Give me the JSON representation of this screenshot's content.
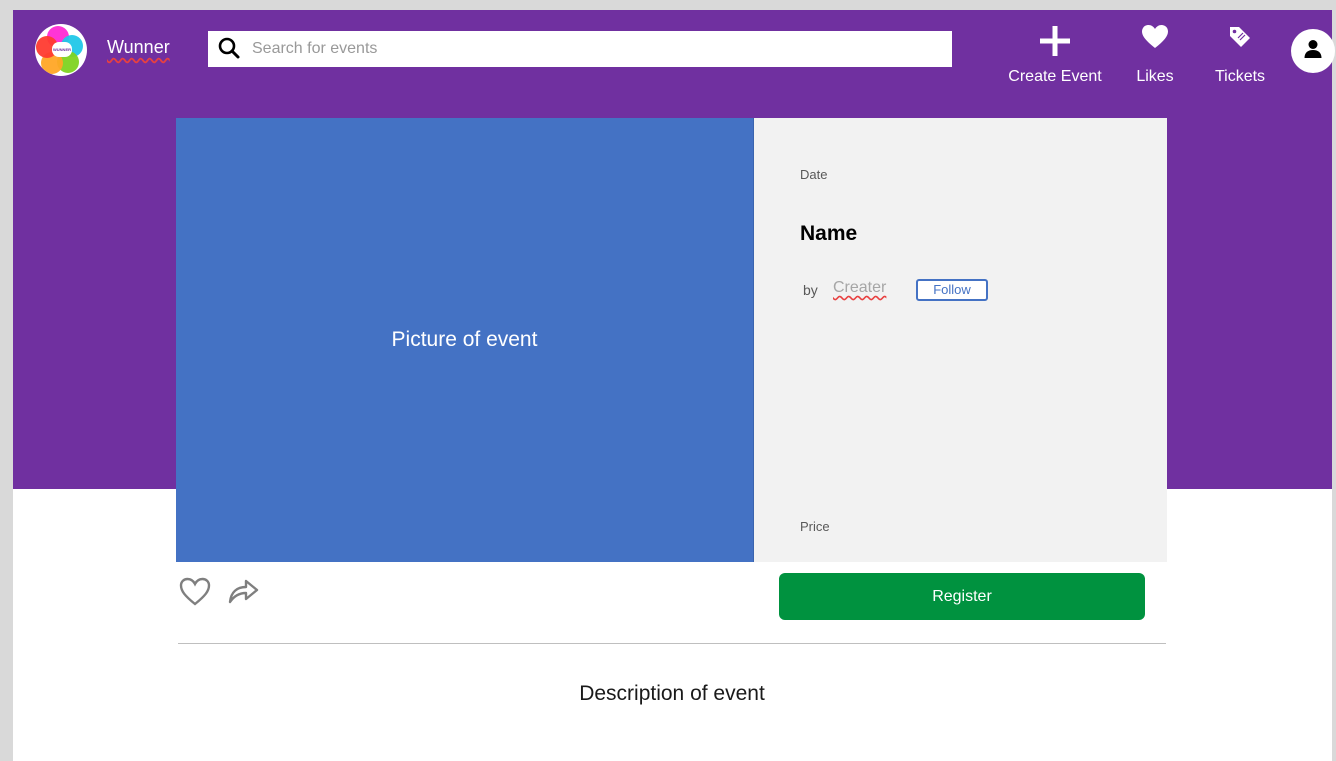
{
  "header": {
    "brand": "Wunner",
    "logo_text": "WUNNER",
    "search": {
      "placeholder": "Search for events",
      "value": ""
    },
    "nav": [
      {
        "label": "Create Event",
        "icon": "plus-icon"
      },
      {
        "label": "Likes",
        "icon": "heart-icon"
      },
      {
        "label": "Tickets",
        "icon": "ticket-tag-icon"
      }
    ],
    "account_icon": "user-icon"
  },
  "event": {
    "picture_label": "Picture of event",
    "date_label": "Date",
    "name": "Name",
    "by_label": "by",
    "creator": "Creater",
    "follow_label": "Follow",
    "price_label": "Price",
    "register_label": "Register",
    "description": "Description of event"
  },
  "colors": {
    "header_bg": "#7030a0",
    "picture_bg": "#4472c4",
    "info_bg": "#f2f2f2",
    "register_bg": "#00923f",
    "follow_border": "#4472c4"
  }
}
